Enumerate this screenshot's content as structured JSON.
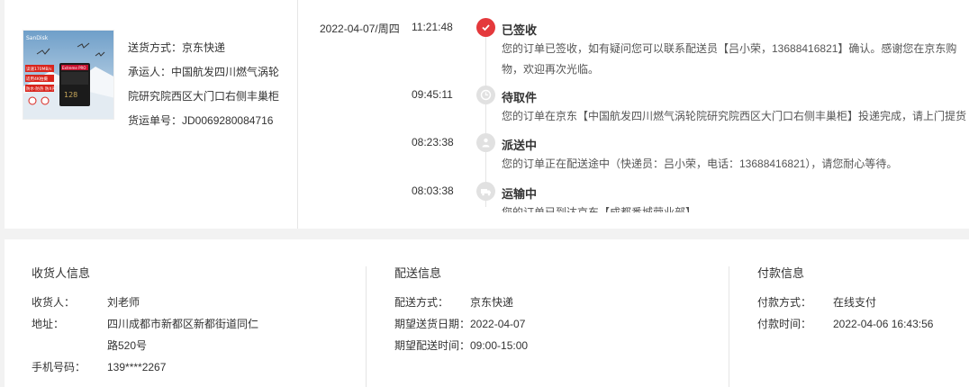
{
  "order": {
    "shipping_method_label": "送货方式：",
    "shipping_method": "京东快递",
    "carrier_label": "承运人：",
    "carrier": "中国航发四川燃气涡轮院研究院西区大门口右侧丰巢柜",
    "tracking_label": "货运单号：",
    "tracking_no": "JD0069280084716",
    "product_image": {
      "brand": "SanDisk",
      "card_text": "Extreme PRO",
      "capacity": "128",
      "badge1": "读速170MB/s",
      "badge2": "适用4K拍摄",
      "badge3": "防水·防热 防X光"
    }
  },
  "tracking": [
    {
      "date": "2022-04-07/周四",
      "time": "11:21:48",
      "status": "已签收",
      "desc": "您的订单已签收，如有疑问您可以联系配送员【吕小荣，13688416821】确认。感谢您在京东购物，欢迎再次光临。",
      "icon": "check-icon",
      "active": true
    },
    {
      "date": "",
      "time": "09:45:11",
      "status": "待取件",
      "desc": "您的订单在京东【中国航发四川燃气涡轮院研究院西区大门口右侧丰巢柜】投递完成，请上门提货",
      "icon": "clock-icon",
      "active": false
    },
    {
      "date": "",
      "time": "08:23:38",
      "status": "派送中",
      "desc": "您的订单正在配送途中（快递员：吕小荣，电话：13688416821），请您耐心等待。",
      "icon": "courier-icon",
      "active": false
    },
    {
      "date": "",
      "time": "08:03:38",
      "status": "运输中",
      "desc": "您的订单已到达京东【成都番城营业部】",
      "icon": "truck-icon",
      "active": false
    }
  ],
  "receiver": {
    "title": "收货人信息",
    "name_label": "收货人：",
    "name": "刘老师",
    "address_label": "地址：",
    "address": "四川成都市新都区新都街道同仁路520号",
    "phone_label": "手机号码：",
    "phone": "139****2267"
  },
  "delivery": {
    "title": "配送信息",
    "method_label": "配送方式：",
    "method": "京东快递",
    "date_label": "期望送货日期：",
    "date": "2022-04-07",
    "time_label": "期望配送时间：",
    "time": "09:00-15:00"
  },
  "payment": {
    "title": "付款信息",
    "method_label": "付款方式：",
    "method": "在线支付",
    "time_label": "付款时间：",
    "time": "2022-04-06 16:43:56"
  },
  "colors": {
    "accent": "#e4393c",
    "inactive_dot": "#e1e1e1"
  }
}
